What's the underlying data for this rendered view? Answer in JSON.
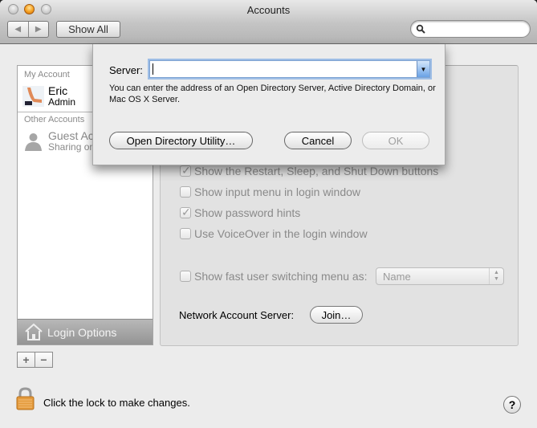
{
  "window": {
    "title": "Accounts",
    "traffic_lights": [
      "close",
      "minimize",
      "zoom"
    ]
  },
  "toolbar": {
    "back_icon": "triangle-left-icon",
    "forward_icon": "triangle-right-icon",
    "back_glyph": "◀",
    "forward_glyph": "▶",
    "show_all_label": "Show All",
    "search": {
      "placeholder": "",
      "value": "",
      "icon": "magnifier-icon"
    }
  },
  "sidebar": {
    "my_account_header": "My Account",
    "other_accounts_header": "Other Accounts",
    "accounts": [
      {
        "name": "Eric",
        "role": "Admin",
        "icon": "user-picture-icon"
      },
      {
        "name": "Guest Ac",
        "role": "Sharing on",
        "icon": "guest-silhouette-icon"
      }
    ],
    "login_options_label": "Login Options",
    "add_glyph": "+",
    "remove_glyph": "−"
  },
  "login_panel": {
    "checkboxes": [
      {
        "label": "Show the Restart, Sleep, and Shut Down buttons",
        "checked": true,
        "enabled": false
      },
      {
        "label": "Show input menu in login window",
        "checked": false,
        "enabled": false
      },
      {
        "label": "Show password hints",
        "checked": true,
        "enabled": false
      },
      {
        "label": "Use VoiceOver in the login window",
        "checked": false,
        "enabled": false
      }
    ],
    "fast_user_switching": {
      "label": "Show fast user switching menu as:",
      "checked": false,
      "enabled": false,
      "selected_value": "Name",
      "arrows_glyph": "▲▼"
    },
    "network_account_server_label": "Network Account Server:",
    "join_label": "Join…"
  },
  "footer": {
    "lock_text": "Click the lock to make changes.",
    "help_glyph": "?"
  },
  "sheet": {
    "server_label": "Server:",
    "server_value": "",
    "server_dropdown_glyph": "▼",
    "help_text": "You can enter the address of an Open Directory Server, Active Directory Domain, or Mac OS X Server.",
    "open_directory_utility_label": "Open Directory Utility…",
    "cancel_label": "Cancel",
    "ok_label": "OK",
    "ok_enabled": false
  },
  "colors": {
    "focus_ring": "#9ebee6",
    "login_options_bg": "#a6a6a6",
    "disabled_text": "#8a8a8a"
  }
}
